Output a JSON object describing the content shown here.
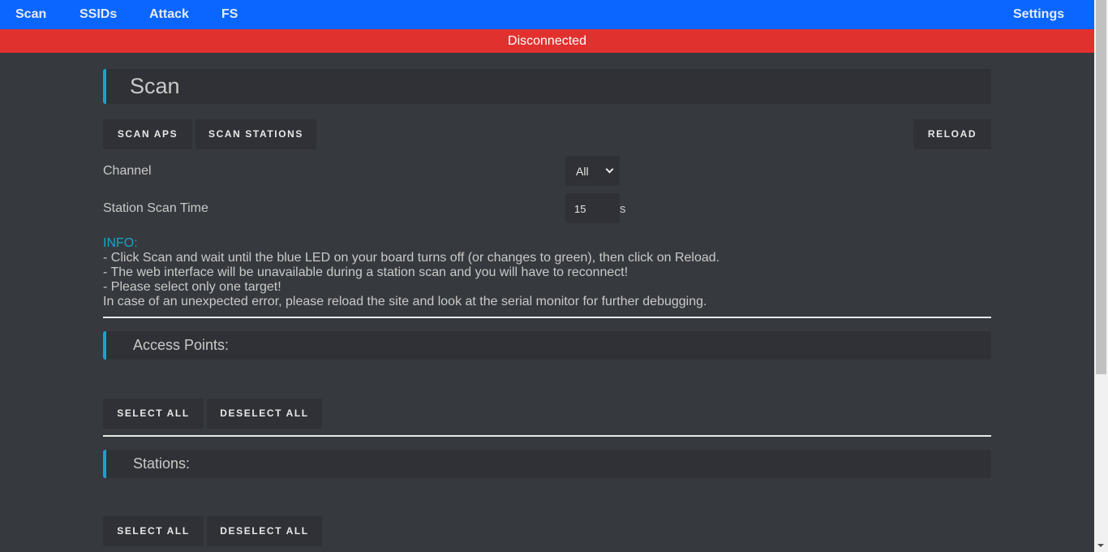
{
  "nav": {
    "scan": "Scan",
    "ssids": "SSIDs",
    "attack": "Attack",
    "fs": "FS",
    "settings": "Settings"
  },
  "status": "Disconnected",
  "scan": {
    "title": "Scan",
    "scan_aps": "SCAN APS",
    "scan_stations": "SCAN STATIONS",
    "reload": "RELOAD",
    "channel_label": "Channel",
    "channel_value": "All",
    "scan_time_label": "Station Scan Time",
    "scan_time_value": "15",
    "scan_time_unit": "s"
  },
  "info": {
    "title": "INFO:",
    "lines": [
      "- Click Scan and wait until the blue LED on your board turns off (or changes to green), then click on Reload.",
      "- The web interface will be unavailable during a station scan and you will have to reconnect!",
      "- Please select only one target!",
      "In case of an unexpected error, please reload the site and look at the serial monitor for further debugging."
    ]
  },
  "access_points": {
    "title": "Access Points:",
    "select_all": "SELECT ALL",
    "deselect_all": "DESELECT ALL"
  },
  "stations": {
    "title": "Stations:",
    "select_all": "SELECT ALL",
    "deselect_all": "DESELECT ALL"
  },
  "colors": {
    "nav": "#0b66ff",
    "status": "#e1312e",
    "accent": "#14a6c9",
    "background": "#36393e",
    "panel": "#2f3136"
  }
}
